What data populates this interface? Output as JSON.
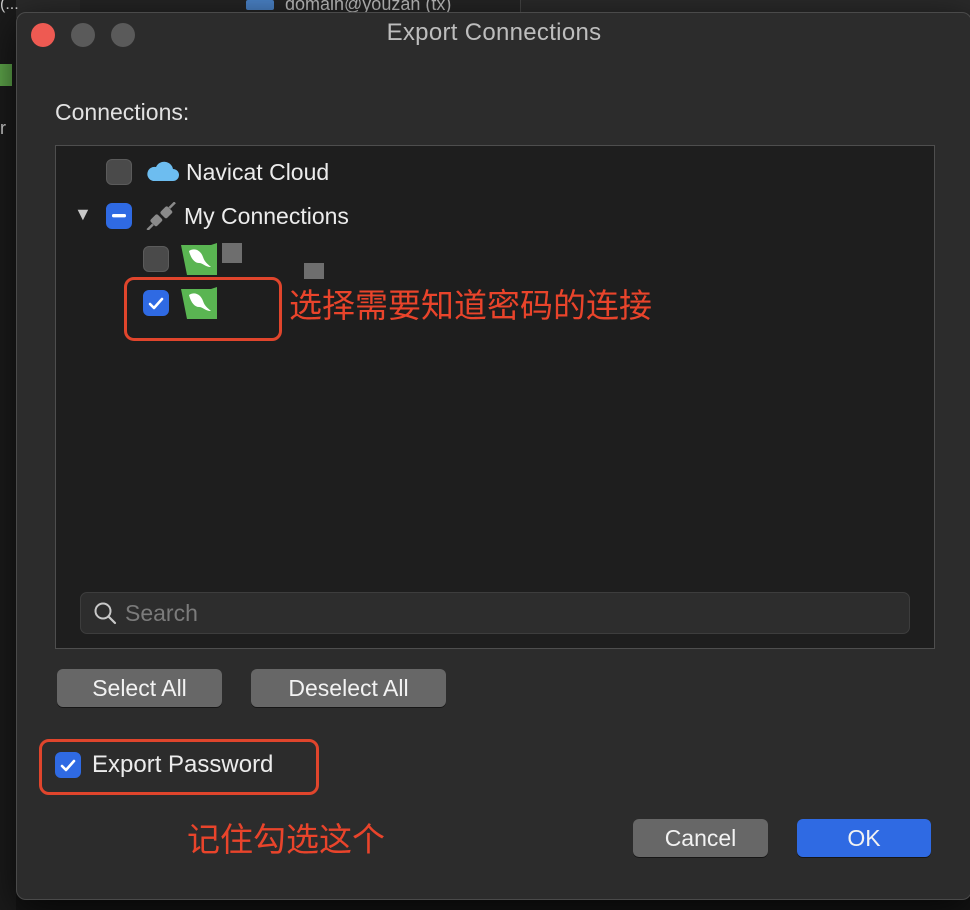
{
  "background": {
    "tab_text": "domain@youzan (tx)",
    "left_text": "(...",
    "left_text2": "r"
  },
  "dialog": {
    "title": "Export Connections",
    "connections_label": "Connections:",
    "tree": [
      {
        "label": "Navicat Cloud",
        "checked": false,
        "icon": "cloud-icon"
      },
      {
        "label": "My Connections",
        "checked": "mixed",
        "icon": "plug-icon"
      },
      {
        "label": "",
        "checked": false,
        "icon": "mysql-icon"
      },
      {
        "label": "",
        "checked": true,
        "icon": "mysql-icon"
      }
    ],
    "search_placeholder": "Search",
    "select_all": "Select All",
    "deselect_all": "Deselect All",
    "export_password": {
      "label": "Export Password",
      "checked": true
    },
    "cancel": "Cancel",
    "ok": "OK"
  },
  "annotations": {
    "select_hint": "选择需要知道密码的连接",
    "remember_hint": "记住勾选这个"
  },
  "colors": {
    "accent": "#2f6ae3",
    "annotation": "#e9442b",
    "mysql_green": "#5ab552"
  }
}
